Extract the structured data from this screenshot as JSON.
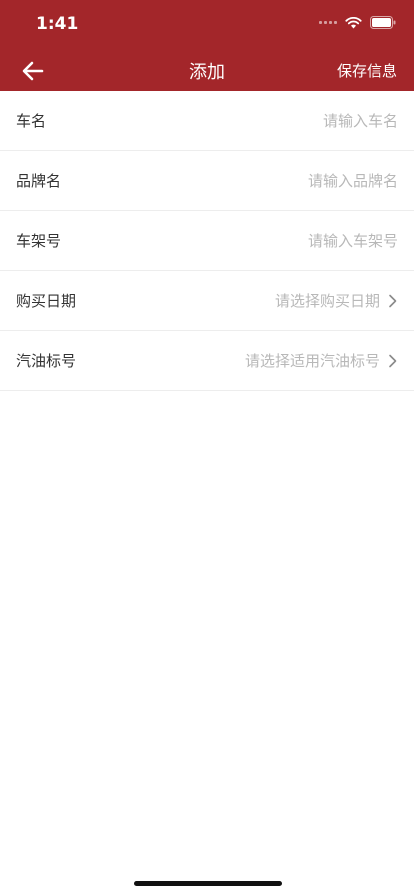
{
  "status_bar": {
    "time": "1:41"
  },
  "nav": {
    "title": "添加",
    "action_label": "保存信息"
  },
  "form": {
    "rows": [
      {
        "label": "车名",
        "placeholder": "请输入车名",
        "type": "input"
      },
      {
        "label": "品牌名",
        "placeholder": "请输入品牌名",
        "type": "input"
      },
      {
        "label": "车架号",
        "placeholder": "请输入车架号",
        "type": "input"
      },
      {
        "label": "购买日期",
        "placeholder": "请选择购买日期",
        "type": "select"
      },
      {
        "label": "汽油标号",
        "placeholder": "请选择适用汽油标号",
        "type": "select"
      }
    ]
  },
  "colors": {
    "header_bg": "#a3262a",
    "placeholder": "#b8b8b8",
    "label": "#333333",
    "divider": "#ededed"
  },
  "icons": [
    "back-arrow-icon",
    "wifi-icon",
    "battery-icon",
    "chevron-right-icon"
  ]
}
